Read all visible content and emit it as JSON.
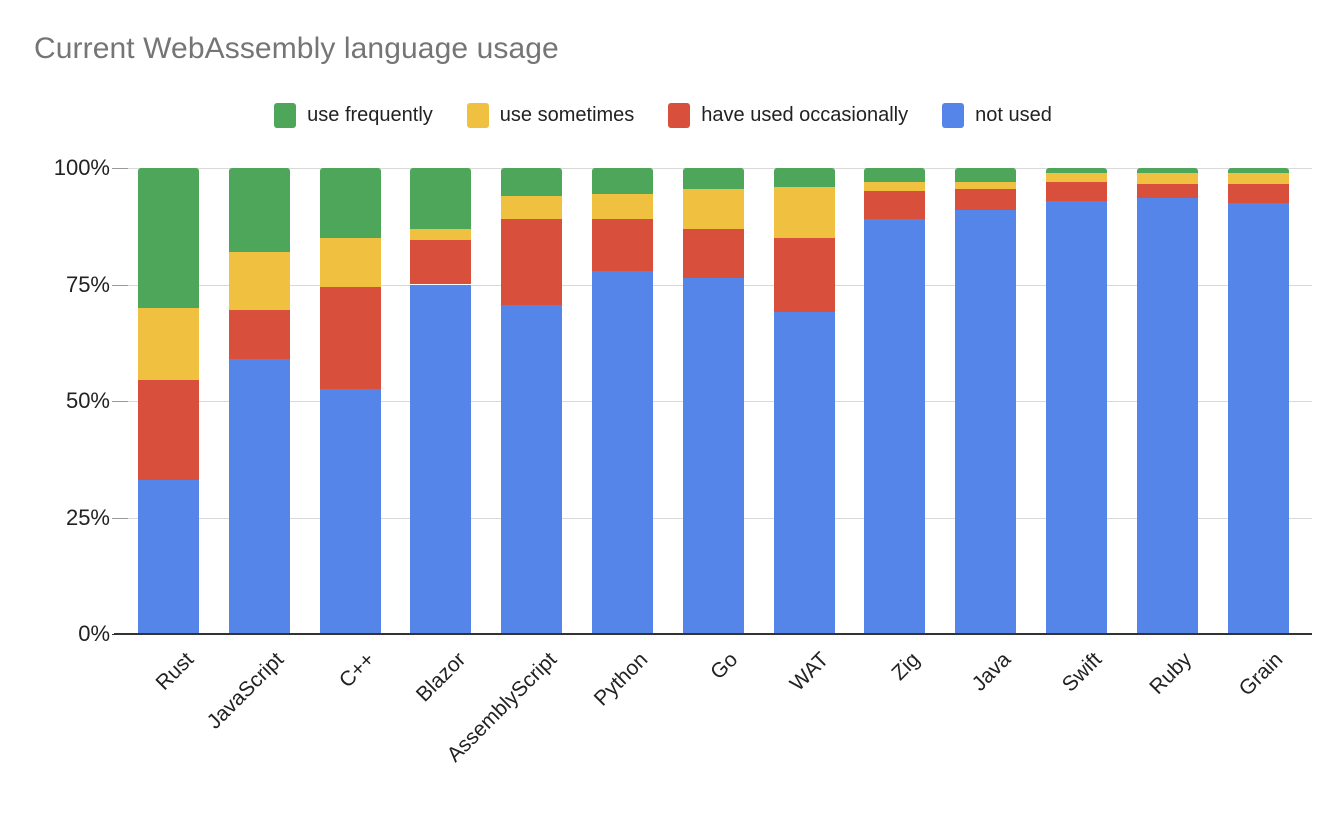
{
  "chart_data": {
    "type": "bar",
    "subtype": "stacked-bar-100-percent",
    "title": "Current WebAssembly language usage",
    "xlabel": "",
    "ylabel": "",
    "ylim": [
      0,
      100
    ],
    "ytick_labels": [
      "0%",
      "25%",
      "50%",
      "75%",
      "100%"
    ],
    "ytick_values": [
      0,
      25,
      50,
      75,
      100
    ],
    "grid": true,
    "legend_position": "top-center",
    "categories": [
      "Rust",
      "JavaScript",
      "C++",
      "Blazor",
      "AssemblyScript",
      "Python",
      "Go",
      "WAT",
      "Zig",
      "Java",
      "Swift",
      "Ruby",
      "Grain"
    ],
    "series": [
      {
        "name": "not used",
        "color": "#5585e8",
        "values": [
          33,
          59,
          52.5,
          75,
          70.5,
          78,
          76.5,
          69,
          89,
          91,
          93,
          93.5,
          92.5
        ]
      },
      {
        "name": "have used occasionally",
        "color": "#d8503c",
        "values": [
          21.5,
          10.5,
          22,
          9.5,
          18.5,
          11,
          10.5,
          16,
          6,
          4.5,
          4,
          3,
          4
        ]
      },
      {
        "name": "use sometimes",
        "color": "#f0c040",
        "values": [
          15.5,
          12.5,
          10.5,
          2.5,
          5,
          5.5,
          8.5,
          11,
          2,
          1.5,
          2,
          2.5,
          2.5
        ]
      },
      {
        "name": "use frequently",
        "color": "#4fa css",
        "values": [
          30,
          18,
          15,
          13,
          6,
          5.5,
          4.5,
          4,
          3,
          3,
          1,
          1,
          1
        ]
      }
    ]
  },
  "legend": {
    "items": [
      {
        "label": "use frequently",
        "color": "#4da65a"
      },
      {
        "label": "use sometimes",
        "color": "#f0c040"
      },
      {
        "label": "have used occasionally",
        "color": "#d8503c"
      },
      {
        "label": "not used",
        "color": "#5585e8"
      }
    ]
  },
  "colors": {
    "use_frequently": "#4da65a",
    "use_sometimes": "#f0c040",
    "have_used_occasionally": "#d8503c",
    "not_used": "#5585e8",
    "title_text": "#757575",
    "axis_text": "#222222",
    "gridline": "#d9d9d9",
    "baseline": "#333333"
  }
}
